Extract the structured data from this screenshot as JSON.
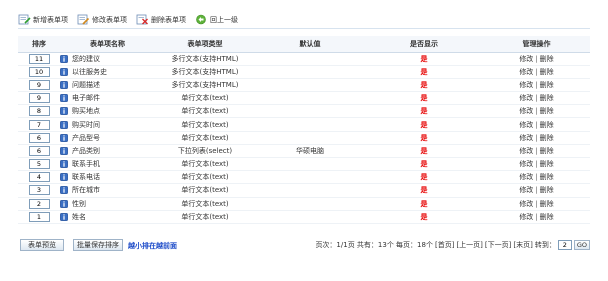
{
  "toolbar": {
    "items": [
      {
        "label": "新增表单项",
        "icon": "add-form-icon"
      },
      {
        "label": "修改表单项",
        "icon": "edit-form-icon"
      },
      {
        "label": "删除表单项",
        "icon": "delete-form-icon"
      },
      {
        "label": "回上一级",
        "icon": "back-up-icon"
      }
    ]
  },
  "table": {
    "headers": {
      "sort": "排序",
      "name": "表单项名称",
      "type": "表单项类型",
      "default": "默认值",
      "show": "是否显示",
      "ops": "管理操作"
    },
    "rows": [
      {
        "sort": "11",
        "name": "您的建议",
        "type": "多行文本(支持HTML)",
        "default": "",
        "show": "是"
      },
      {
        "sort": "10",
        "name": "以往服务史",
        "type": "多行文本(支持HTML)",
        "default": "",
        "show": "是"
      },
      {
        "sort": "9",
        "name": "问题描述",
        "type": "多行文本(支持HTML)",
        "default": "",
        "show": "是"
      },
      {
        "sort": "9",
        "name": "电子邮件",
        "type": "单行文本(text)",
        "default": "",
        "show": "是"
      },
      {
        "sort": "8",
        "name": "购买地点",
        "type": "单行文本(text)",
        "default": "",
        "show": "是"
      },
      {
        "sort": "7",
        "name": "购买时间",
        "type": "单行文本(text)",
        "default": "",
        "show": "是"
      },
      {
        "sort": "6",
        "name": "产品型号",
        "type": "单行文本(text)",
        "default": "",
        "show": "是"
      },
      {
        "sort": "6",
        "name": "产品类别",
        "type": "下拉列表(select)",
        "default": "华硕电脑",
        "show": "是"
      },
      {
        "sort": "5",
        "name": "联系手机",
        "type": "单行文本(text)",
        "default": "",
        "show": "是"
      },
      {
        "sort": "4",
        "name": "联系电话",
        "type": "单行文本(text)",
        "default": "",
        "show": "是"
      },
      {
        "sort": "3",
        "name": "所在城市",
        "type": "单行文本(text)",
        "default": "",
        "show": "是"
      },
      {
        "sort": "2",
        "name": "性别",
        "type": "单行文本(text)",
        "default": "",
        "show": "是"
      },
      {
        "sort": "1",
        "name": "姓名",
        "type": "单行文本(text)",
        "default": "",
        "show": "是"
      }
    ],
    "op_edit": "修改",
    "op_sep": "|",
    "op_delete": "删除"
  },
  "bottom": {
    "preview_label": "表单预览",
    "save_sort_label": "批量保存排序",
    "drag_tip": "越小排在越前面"
  },
  "pager": {
    "page_info": "页次：1/1页 共有：13个 每页：18个",
    "first": "[首页]",
    "prev": "[上一页]",
    "next": "[下一页]",
    "last": "[末页]",
    "jump_label": "转到：",
    "jump_value": "2",
    "go_label": "GO"
  },
  "colors": {
    "show_yes": "#e60000",
    "tip_blue": "#1a49c8",
    "header_bg": "#f4f7fb",
    "info_icon_blue": "#3a6fc4"
  }
}
